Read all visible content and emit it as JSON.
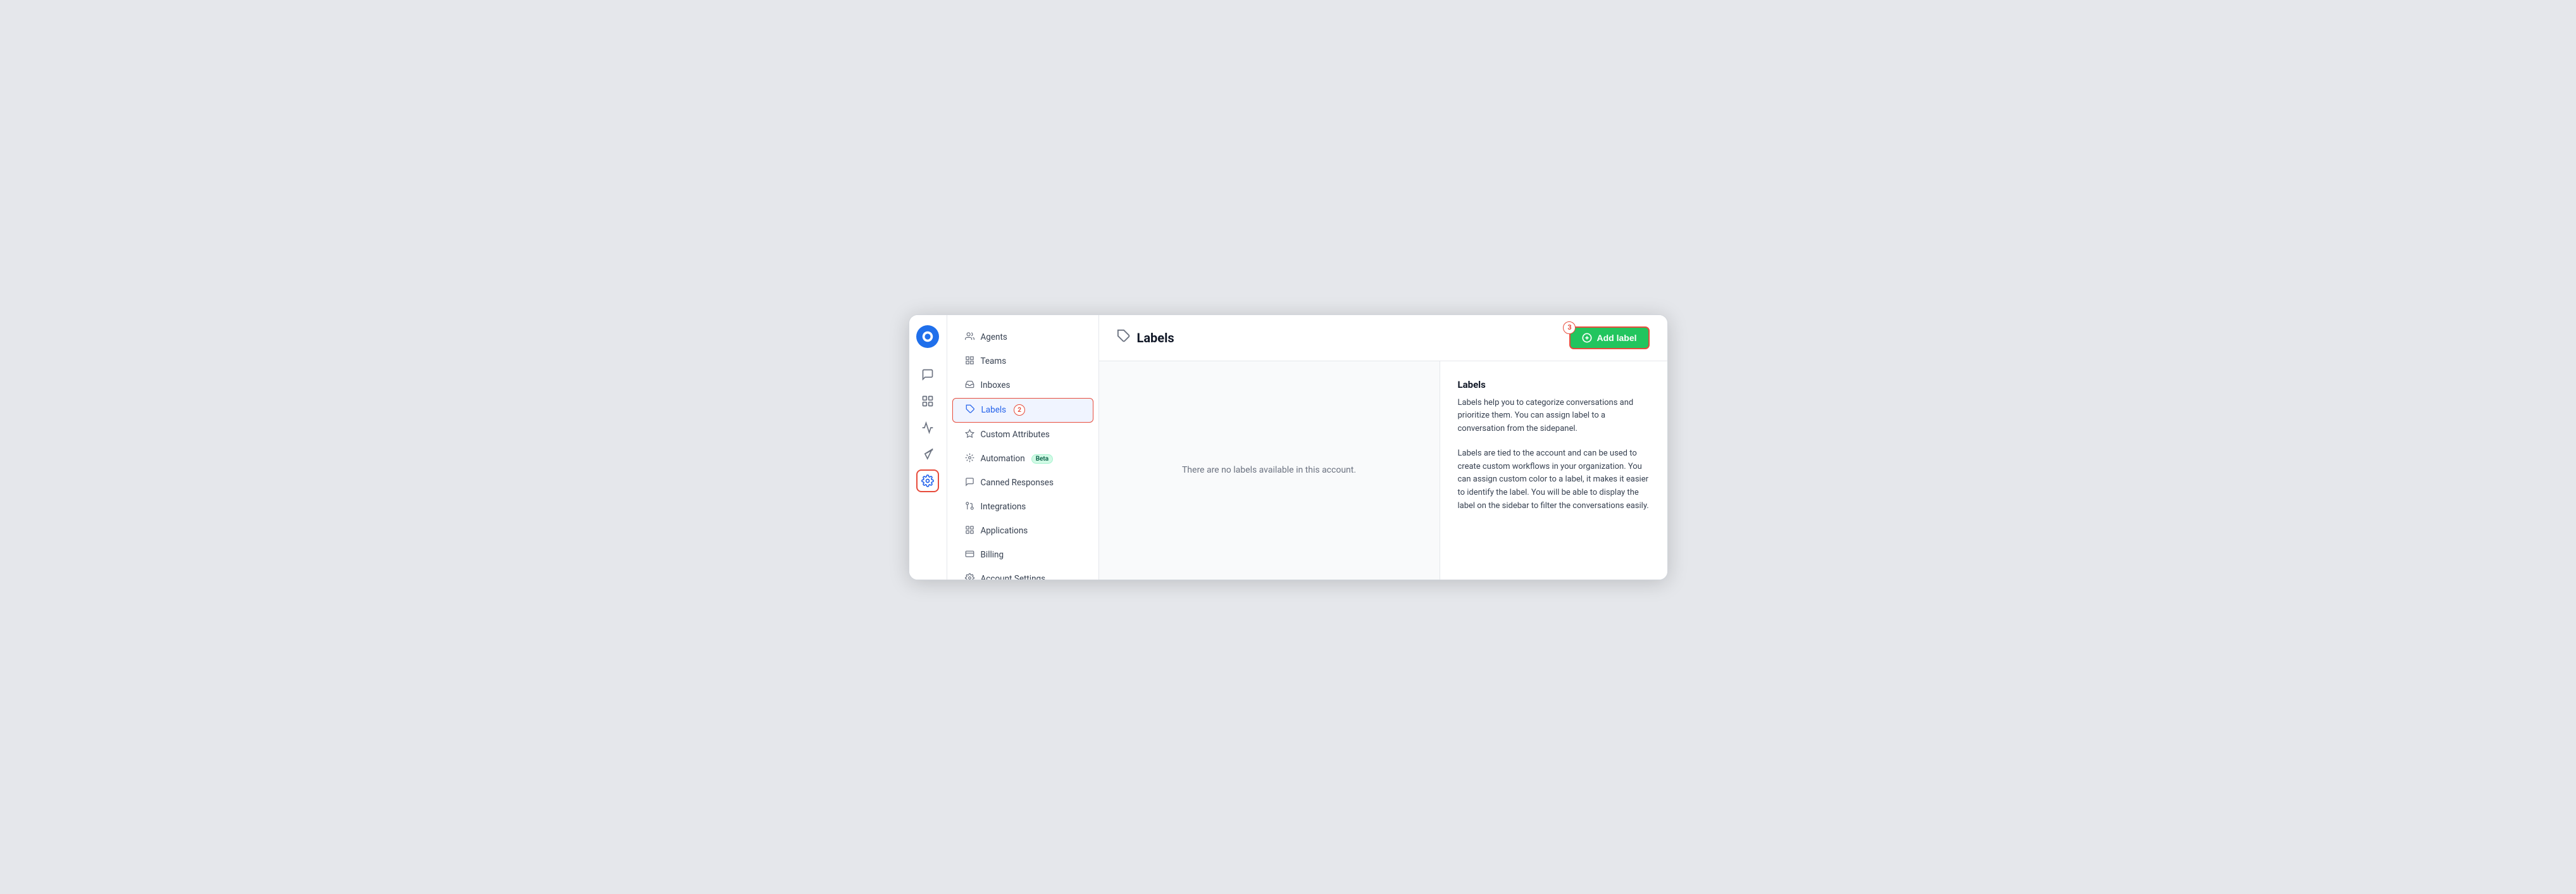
{
  "app": {
    "title": "Labels"
  },
  "sidebar": {
    "items": [
      {
        "id": "agents",
        "label": "Agents",
        "icon": "👥",
        "active": false
      },
      {
        "id": "teams",
        "label": "Teams",
        "icon": "⊞",
        "active": false
      },
      {
        "id": "inboxes",
        "label": "Inboxes",
        "icon": "🗂",
        "active": false
      },
      {
        "id": "labels",
        "label": "Labels",
        "icon": "🏷",
        "active": true
      },
      {
        "id": "custom-attributes",
        "label": "Custom Attributes",
        "icon": "◇",
        "active": false
      },
      {
        "id": "automation",
        "label": "Automation",
        "icon": "⚙",
        "active": false,
        "badge": "Beta"
      },
      {
        "id": "canned-responses",
        "label": "Canned Responses",
        "icon": "💬",
        "active": false
      },
      {
        "id": "integrations",
        "label": "Integrations",
        "icon": "🔌",
        "active": false
      },
      {
        "id": "applications",
        "label": "Applications",
        "icon": "⊟",
        "active": false
      },
      {
        "id": "billing",
        "label": "Billing",
        "icon": "🖥",
        "active": false
      },
      {
        "id": "account-settings",
        "label": "Account Settings",
        "icon": "⚙",
        "active": false
      }
    ]
  },
  "rail": {
    "icons": [
      {
        "id": "conversations",
        "symbol": "💬"
      },
      {
        "id": "contacts",
        "symbol": "👤"
      },
      {
        "id": "reports",
        "symbol": "📈"
      },
      {
        "id": "campaigns",
        "symbol": "📣"
      },
      {
        "id": "settings",
        "symbol": "⚙",
        "active": true
      }
    ]
  },
  "header": {
    "title": "Labels",
    "title_icon": "🏷",
    "add_button_label": "Add label",
    "badge_number": "3"
  },
  "empty_message": "There are no labels available in this account.",
  "info_panel": {
    "title": "Labels",
    "paragraph1": "Labels help you to categorize conversations and prioritize them. You can assign label to a conversation from the sidepanel.",
    "paragraph2": "Labels are tied to the account and can be used to create custom workflows in your organization. You can assign custom color to a label, it makes it easier to identify the label. You will be able to display the label on the sidebar to filter the conversations easily."
  },
  "colors": {
    "accent": "#2563eb",
    "danger": "#e74c3c",
    "success": "#22c55e",
    "logo_bg": "#1f6feb"
  }
}
